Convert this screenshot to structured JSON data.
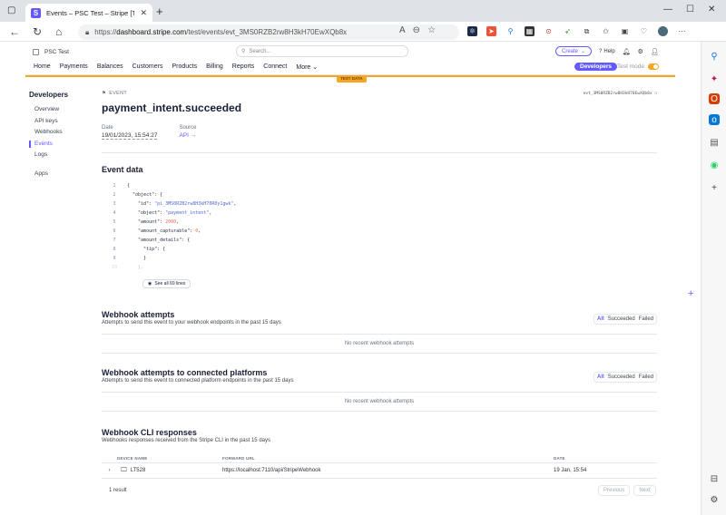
{
  "browser": {
    "tab_title": "Events – PSC Test – Stripe [Test]",
    "url_domain": "dashboard.stripe.com",
    "url_prefix": "https://",
    "url_path": "/test/events/evt_3MS0RZB2rw8H3kH70EwXQb8x"
  },
  "header": {
    "account": "PSC Test",
    "search_placeholder": "Search...",
    "create": "Create",
    "help": "Help"
  },
  "nav": {
    "items": [
      "Home",
      "Payments",
      "Balances",
      "Customers",
      "Products",
      "Billing",
      "Reports",
      "Connect",
      "More"
    ],
    "developers": "Developers",
    "test_mode": "Test mode",
    "test_data": "TEST DATA"
  },
  "sidebar": {
    "title": "Developers",
    "items": [
      "Overview",
      "API keys",
      "Webhooks",
      "Events",
      "Logs",
      "Apps"
    ],
    "active": "Events"
  },
  "event": {
    "kicker": "EVENT",
    "id": "evt_3MS0RZB2rw8H3kH70EwXQb8x",
    "title": "payment_intent.succeeded",
    "date_label": "Date",
    "date_value": "19/01/2023, 15:54:27",
    "source_label": "Source",
    "source_value": "API →"
  },
  "event_data": {
    "title": "Event data",
    "lines": [
      {
        "n": "1",
        "t": "{"
      },
      {
        "n": "2",
        "t": "  \"object\": {"
      },
      {
        "n": "3",
        "k": "    \"id\": ",
        "s": "\"pi_3MS0RZB2rw8H3kH70R0y1gwk\"",
        "e": ","
      },
      {
        "n": "4",
        "k": "    \"object\": ",
        "s": "\"payment_intent\"",
        "e": ","
      },
      {
        "n": "5",
        "k": "    \"amount\": ",
        "v": "2000",
        "e": ","
      },
      {
        "n": "6",
        "k": "    \"amount_capturable\": ",
        "v": "0",
        "e": ","
      },
      {
        "n": "7",
        "t": "    \"amount_details\": {"
      },
      {
        "n": "8",
        "t": "      \"tip\": {"
      },
      {
        "n": "9",
        "t": "      }"
      },
      {
        "n": "10",
        "t": "    },"
      }
    ],
    "see_all": "See all 69 lines"
  },
  "webhook_attempts": {
    "title": "Webhook attempts",
    "subtitle": "Attempts to send this event to your webhook endpoints in the past 15 days",
    "filters": [
      "All",
      "Succeeded",
      "Failed"
    ],
    "empty": "No recent webhook attempts"
  },
  "connected_attempts": {
    "title": "Webhook attempts to connected platforms",
    "subtitle": "Attempts to send this event to connected platform endpoints in the past 15 days",
    "filters": [
      "All",
      "Succeeded",
      "Failed"
    ],
    "empty": "No recent webhook attempts"
  },
  "cli": {
    "title": "Webhook CLI responses",
    "subtitle": "Webhooks responses received from the Stripe CLI in the past 15 days",
    "headers": [
      "DEVICE NAME",
      "FORWARD URL",
      "DATE"
    ],
    "rows": [
      {
        "device": "LT528",
        "url": "https://localhost:7110/api/StripeWebhook",
        "date": "19 Jan, 15:54"
      }
    ],
    "result_count": "1 result",
    "previous": "Previous",
    "next": "Next"
  },
  "colors": {
    "accent": "#635bff",
    "test_orange": "#f5a623"
  }
}
